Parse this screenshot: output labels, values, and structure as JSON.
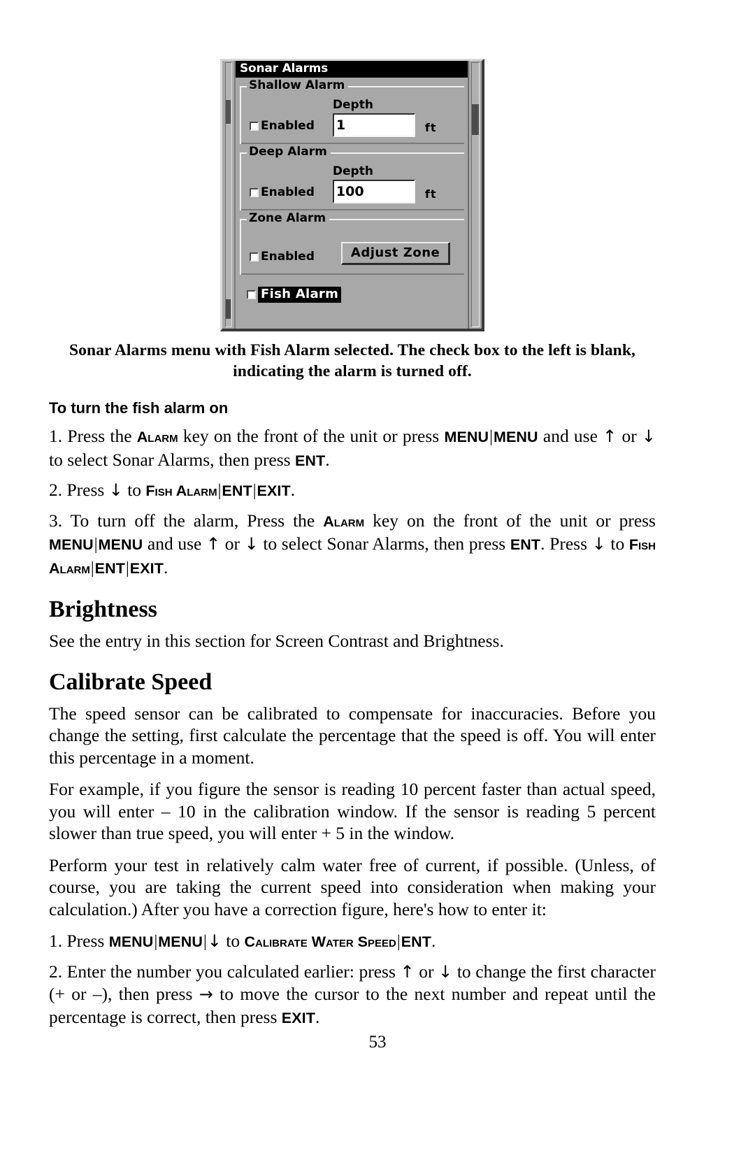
{
  "figure": {
    "title": "Sonar Alarms",
    "groups": [
      {
        "legend": "Shallow Alarm",
        "checkbox_label": "Enabled",
        "field_label": "Depth",
        "field_value": "1",
        "field_unit": "ft"
      },
      {
        "legend": "Deep Alarm",
        "checkbox_label": "Enabled",
        "field_label": "Depth",
        "field_value": "100",
        "field_unit": "ft"
      },
      {
        "legend": "Zone Alarm",
        "checkbox_label": "Enabled",
        "button_label": "Adjust Zone"
      }
    ],
    "fish_alarm_label": "Fish Alarm"
  },
  "caption": "Sonar Alarms menu with Fish Alarm selected. The check box to the left is blank, indicating the alarm is turned off.",
  "sections": {
    "fish_alarm_heading": "To turn the fish alarm on",
    "step1": {
      "num": "1. Press the ",
      "key_alarm": "Alarm",
      "t2": " key on the front of the unit or press ",
      "key_menu1": "MENU",
      "bar1": "|",
      "key_menu2": "MENU",
      "t3": " and use ",
      "arrow_up": "↑",
      "t4": " or ",
      "arrow_dn": "↓",
      "t5": " to select Sonar Alarms, then press ",
      "key_ent": "ENT",
      "t6": "."
    },
    "step2": {
      "t1": "2. Press ",
      "arrow_dn": "↓",
      "t2": " to ",
      "key_fish": "Fish Alarm",
      "bar1": "|",
      "key_ent": "ENT",
      "bar2": "|",
      "key_exit": "EXIT",
      "t3": "."
    },
    "step3": {
      "t1": "3. To turn off the alarm, Press the ",
      "key_alarm": "Alarm",
      "t2": " key on the front of the unit or press ",
      "key_menu1": "MENU",
      "bar1": "|",
      "key_menu2": "MENU",
      "t3": " and use ",
      "arrow_up": "↑",
      "t4": " or ",
      "arrow_dn": "↓",
      "t5": " to select Sonar Alarms, then press ",
      "key_ent1": "ENT",
      "t6": ". Press ",
      "arrow_dn2": "↓",
      "t7": " to  ",
      "key_fish": "Fish Alarm",
      "bar2": "|",
      "key_ent2": "ENT",
      "bar3": "|",
      "key_exit": "EXIT",
      "t8": "."
    },
    "brightness_heading": "Brightness",
    "brightness_body": "See the entry in this section for Screen Contrast and Brightness.",
    "calibrate_heading": "Calibrate Speed",
    "calibrate_p1": "The speed sensor can be calibrated to compensate for inaccuracies. Before you change the setting, first calculate the percentage that the speed is off. You will enter this percentage in a moment.",
    "calibrate_p2": "For example, if you figure the sensor is reading 10 percent faster than actual speed, you will enter – 10 in the calibration window. If the sensor is reading 5 percent slower than true speed, you will enter + 5 in the window.",
    "calibrate_p3": "Perform your test in relatively calm water free of current, if possible. (Unless, of course, you are taking the current speed into consideration when making your calculation.) After you have a correction figure, here's how to enter it:",
    "cal_step1": {
      "t1": "1. Press ",
      "key_menu1": "MENU",
      "bar1": "|",
      "key_menu2": "MENU",
      "bar2": "|",
      "arrow_dn": "↓",
      "t2": " to ",
      "key_cal": "Calibrate Water Speed",
      "bar3": "|",
      "key_ent": "ENT",
      "t3": "."
    },
    "cal_step2": {
      "t1": "2. Enter the number you calculated earlier: press ",
      "arrow_up": "↑",
      "t2": " or ",
      "arrow_dn": "↓",
      "t3": " to change the first character (+ or –), then press ",
      "arrow_rt": "→",
      "t4": " to move the cursor to the next number and repeat until the percentage is correct, then press ",
      "key_exit": "EXIT",
      "t5": "."
    }
  },
  "page_number": "53"
}
